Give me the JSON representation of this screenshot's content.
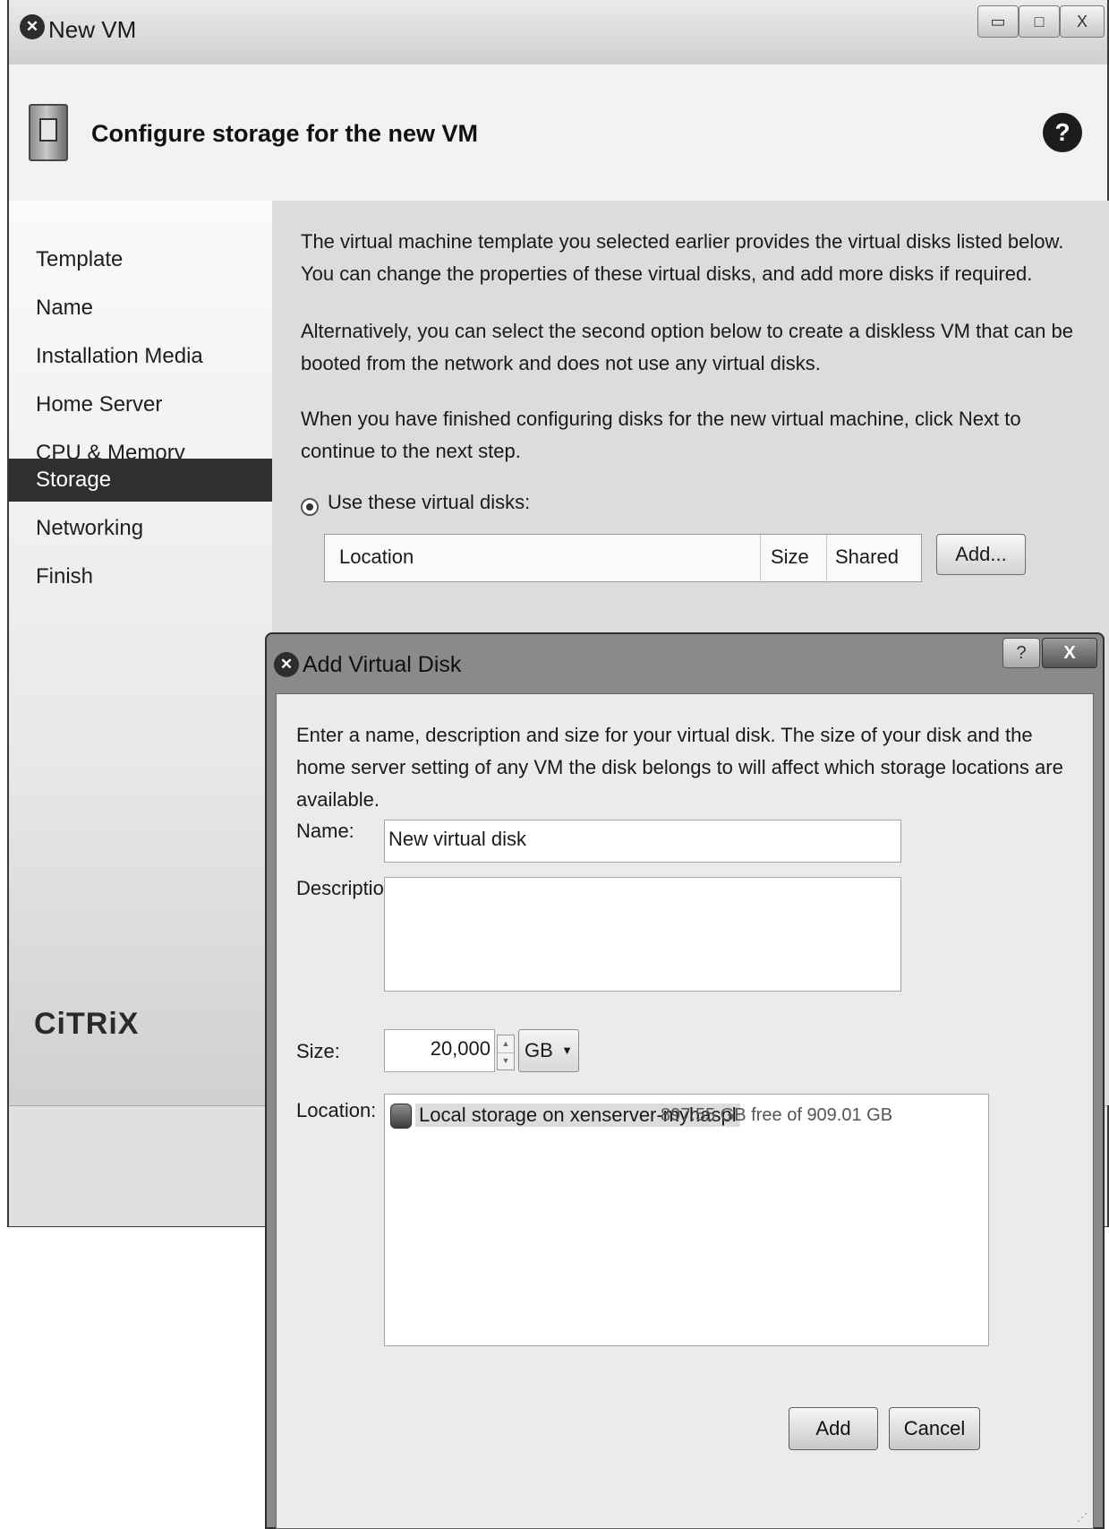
{
  "main_window": {
    "title": "New VM",
    "minimize_glyph": "▭",
    "maximize_glyph": "□",
    "close_glyph": "X",
    "title_icon": "xencenter-icon"
  },
  "header": {
    "title": "Configure storage for the new VM",
    "help_glyph": "?"
  },
  "sidebar": {
    "items": [
      {
        "label": "Template"
      },
      {
        "label": "Name"
      },
      {
        "label": "Installation Media"
      },
      {
        "label": "Home Server"
      },
      {
        "label": "CPU & Memory"
      },
      {
        "label": "Storage",
        "active": true
      },
      {
        "label": "Networking"
      },
      {
        "label": "Finish"
      }
    ],
    "logo": "CiTRiX"
  },
  "content": {
    "para1": "The virtual machine template you selected earlier provides the virtual disks listed below. You can change the properties of these virtual disks, and add more disks if required.",
    "para2": "Alternatively, you can select the second option below to create a diskless VM that can be booted from the network and does not use any virtual disks.",
    "para3": "When you have finished configuring disks for the new virtual machine, click Next to continue to the next step.",
    "radio_label": "Use these virtual disks:",
    "table_headers": {
      "location": "Location",
      "size": "Size",
      "shared": "Shared"
    },
    "add_button": "Add..."
  },
  "dialog": {
    "title": "Add Virtual Disk",
    "help_glyph": "?",
    "close_glyph": "X",
    "description": "Enter a name, description and size for your virtual disk. The size of your disk and the home server setting of any VM the disk belongs to will affect which storage locations are available.",
    "name_label": "Name:",
    "name_value": "New virtual disk",
    "description_label": "Description:",
    "description_value": "",
    "size_label": "Size:",
    "size_value": "20,000",
    "unit": "GB",
    "location_label": "Location:",
    "location_name": "Local storage on xenserver-myhaspl",
    "location_free": "897.55 GB free of 909.01 GB",
    "add_button": "Add",
    "cancel_button": "Cancel"
  }
}
